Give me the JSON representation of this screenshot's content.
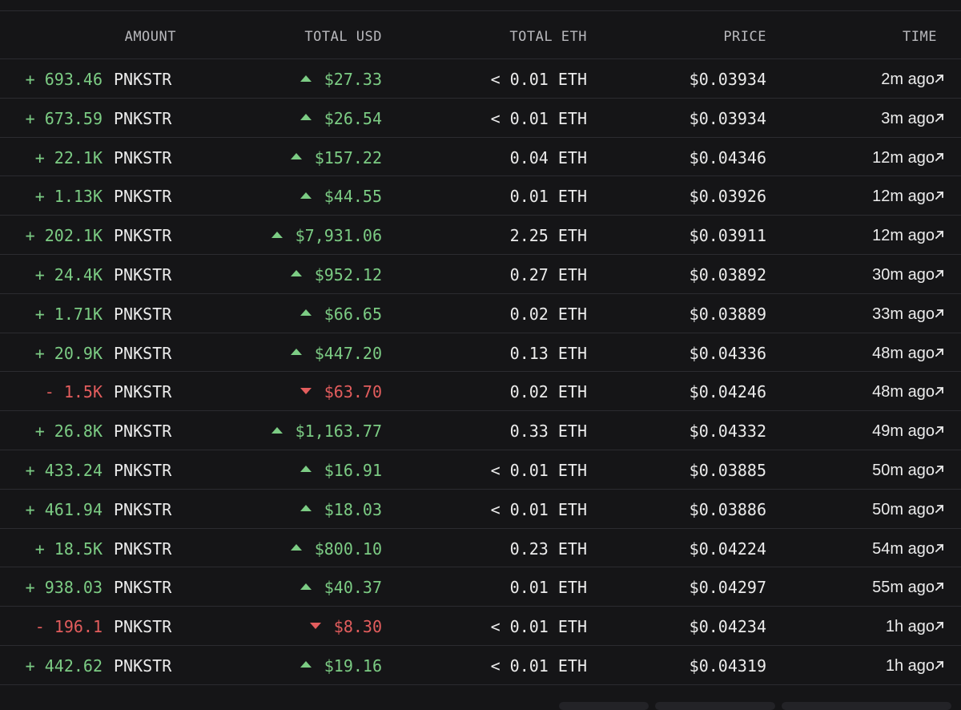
{
  "table": {
    "headers": {
      "amount": "AMOUNT",
      "total_usd": "TOTAL USD",
      "total_eth": "TOTAL ETH",
      "price": "PRICE",
      "time": "TIME"
    },
    "rows": [
      {
        "amount": "+ 693.46",
        "token": "PNKSTR",
        "usd": "$27.33",
        "eth": "< 0.01 ETH",
        "price": "$0.03934",
        "time": "2m ago",
        "side": "buy"
      },
      {
        "amount": "+ 673.59",
        "token": "PNKSTR",
        "usd": "$26.54",
        "eth": "< 0.01 ETH",
        "price": "$0.03934",
        "time": "3m ago",
        "side": "buy"
      },
      {
        "amount": "+ 22.1K",
        "token": "PNKSTR",
        "usd": "$157.22",
        "eth": "0.04 ETH",
        "price": "$0.04346",
        "time": "12m ago",
        "side": "buy"
      },
      {
        "amount": "+ 1.13K",
        "token": "PNKSTR",
        "usd": "$44.55",
        "eth": "0.01 ETH",
        "price": "$0.03926",
        "time": "12m ago",
        "side": "buy"
      },
      {
        "amount": "+ 202.1K",
        "token": "PNKSTR",
        "usd": "$7,931.06",
        "eth": "2.25 ETH",
        "price": "$0.03911",
        "time": "12m ago",
        "side": "buy"
      },
      {
        "amount": "+ 24.4K",
        "token": "PNKSTR",
        "usd": "$952.12",
        "eth": "0.27 ETH",
        "price": "$0.03892",
        "time": "30m ago",
        "side": "buy"
      },
      {
        "amount": "+ 1.71K",
        "token": "PNKSTR",
        "usd": "$66.65",
        "eth": "0.02 ETH",
        "price": "$0.03889",
        "time": "33m ago",
        "side": "buy"
      },
      {
        "amount": "+ 20.9K",
        "token": "PNKSTR",
        "usd": "$447.20",
        "eth": "0.13 ETH",
        "price": "$0.04336",
        "time": "48m ago",
        "side": "buy"
      },
      {
        "amount": "- 1.5K",
        "token": "PNKSTR",
        "usd": "$63.70",
        "eth": "0.02 ETH",
        "price": "$0.04246",
        "time": "48m ago",
        "side": "sell"
      },
      {
        "amount": "+ 26.8K",
        "token": "PNKSTR",
        "usd": "$1,163.77",
        "eth": "0.33 ETH",
        "price": "$0.04332",
        "time": "49m ago",
        "side": "buy"
      },
      {
        "amount": "+ 433.24",
        "token": "PNKSTR",
        "usd": "$16.91",
        "eth": "< 0.01 ETH",
        "price": "$0.03885",
        "time": "50m ago",
        "side": "buy"
      },
      {
        "amount": "+ 461.94",
        "token": "PNKSTR",
        "usd": "$18.03",
        "eth": "< 0.01 ETH",
        "price": "$0.03886",
        "time": "50m ago",
        "side": "buy"
      },
      {
        "amount": "+ 18.5K",
        "token": "PNKSTR",
        "usd": "$800.10",
        "eth": "0.23 ETH",
        "price": "$0.04224",
        "time": "54m ago",
        "side": "buy"
      },
      {
        "amount": "+ 938.03",
        "token": "PNKSTR",
        "usd": "$40.37",
        "eth": "0.01 ETH",
        "price": "$0.04297",
        "time": "55m ago",
        "side": "buy"
      },
      {
        "amount": "- 196.1",
        "token": "PNKSTR",
        "usd": "$8.30",
        "eth": "< 0.01 ETH",
        "price": "$0.04234",
        "time": "1h ago",
        "side": "sell"
      },
      {
        "amount": "+ 442.62",
        "token": "PNKSTR",
        "usd": "$19.16",
        "eth": "< 0.01 ETH",
        "price": "$0.04319",
        "time": "1h ago",
        "side": "buy"
      }
    ]
  },
  "colors": {
    "background": "#151517",
    "buy": "#7ccc84",
    "sell": "#e35d5d",
    "divider": "#2b2b30",
    "header_text": "#b8b8bc"
  },
  "icons": {
    "up": "triangle-up-icon",
    "down": "triangle-down-icon",
    "link": "external-link-icon"
  }
}
